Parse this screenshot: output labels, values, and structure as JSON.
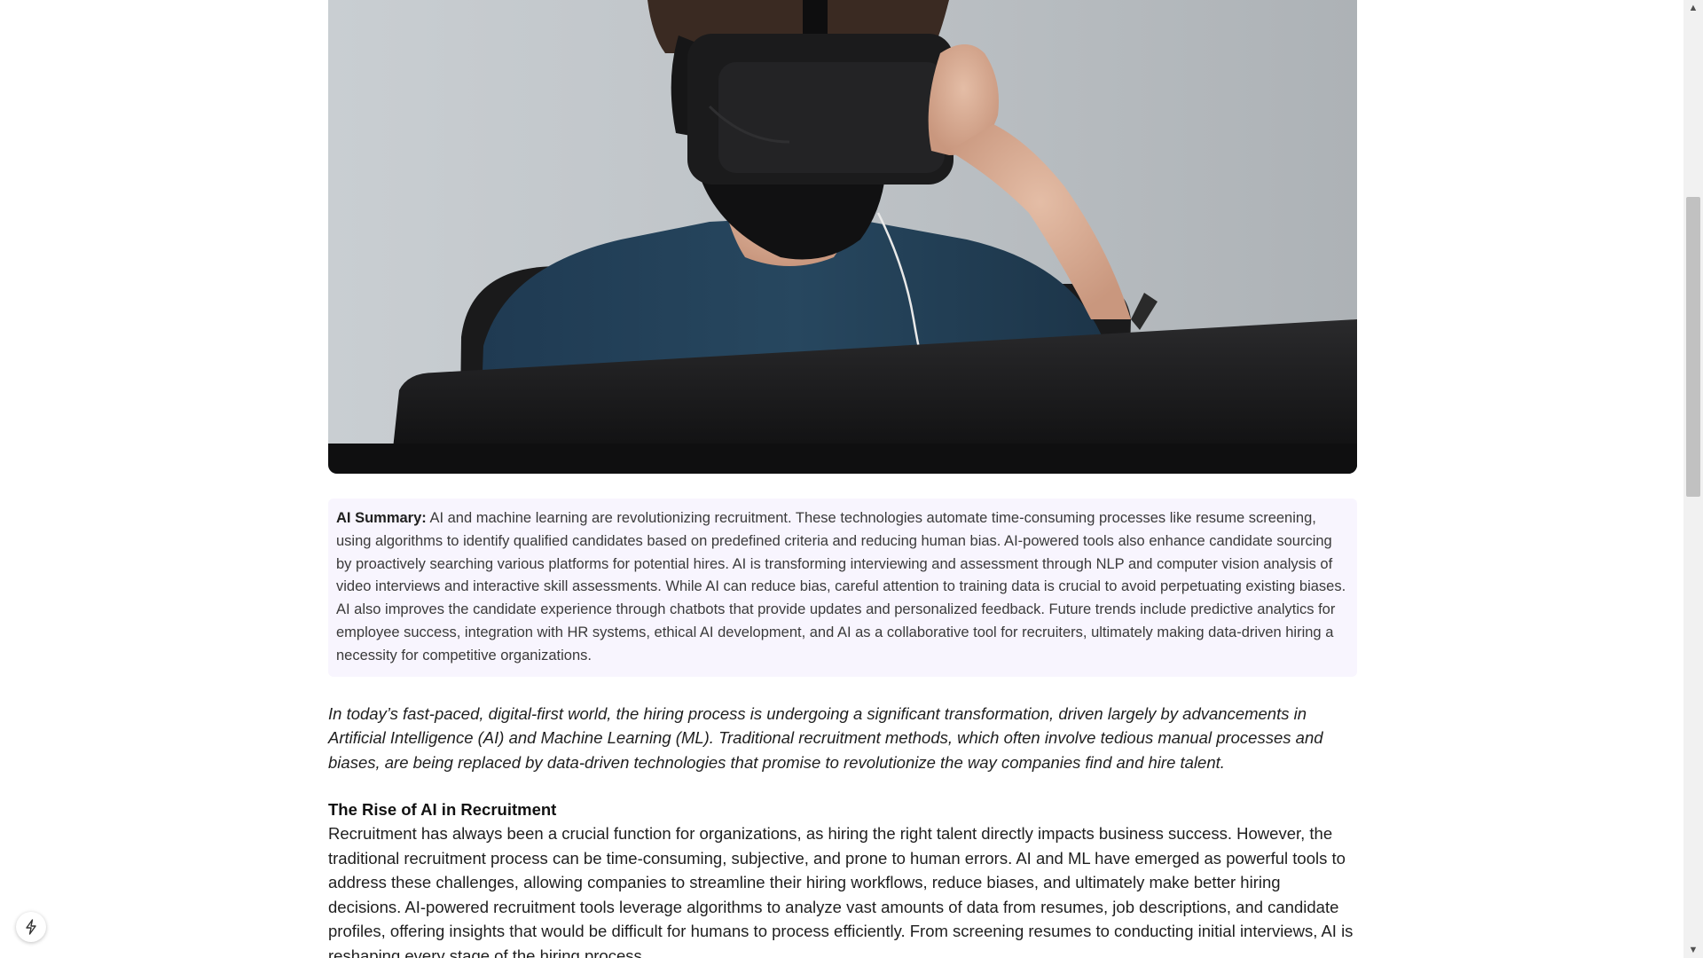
{
  "summary": {
    "label": "AI Summary:",
    "text": " AI and machine learning are revolutionizing recruitment. These technologies automate time-consuming processes like resume screening, using algorithms to identify qualified candidates based on predefined criteria and reducing human bias. AI-powered tools also enhance candidate sourcing by proactively searching various platforms for potential hires. AI is transforming interviewing and assessment through NLP and computer vision analysis of video interviews and interactive skill assessments. While AI can reduce bias, careful attention to training data is crucial to avoid perpetuating existing biases. AI also improves the candidate experience through chatbots that provide updates and personalized feedback. Future trends include predictive analytics for employee success, integration with HR systems, ethical AI development, and AI as a collaborative tool for recruiters, ultimately making data-driven hiring a necessity for competitive organizations."
  },
  "intro": "In today’s fast-paced, digital-first world, the hiring process is undergoing a significant transformation, driven largely by advancements in Artificial Intelligence (AI) and Machine Learning (ML). Traditional recruitment methods, which often involve tedious manual processes and biases, are being replaced by data-driven technologies that promise to revolutionize the way companies find and hire talent.",
  "section": {
    "heading": "The Rise of AI in Recruitment",
    "body": "Recruitment has always been a crucial function for organizations, as hiring the right talent directly impacts business success. However, the traditional recruitment process can be time-consuming, subjective, and prone to human errors. AI and ML have emerged as powerful tools to address these challenges, allowing companies to streamline their hiring workflows, reduce biases, and ultimately make better hiring decisions. AI-powered recruitment tools leverage algorithms to analyze vast amounts of data from resumes, job descriptions, and candidate profiles, offering insights that would be difficult for humans to process efficiently. From screening resumes to conducting initial interviews, AI is reshaping every stage of the hiring process."
  },
  "icons": {
    "hero": "person-wearing-vr-headset-photo",
    "floating_button": "lightning-bolt-icon",
    "scroll_up": "triangle-up-icon",
    "scroll_down": "triangle-down-icon"
  },
  "colors": {
    "summary_background": "#f8f5fe",
    "page_background": "#ffffff"
  }
}
